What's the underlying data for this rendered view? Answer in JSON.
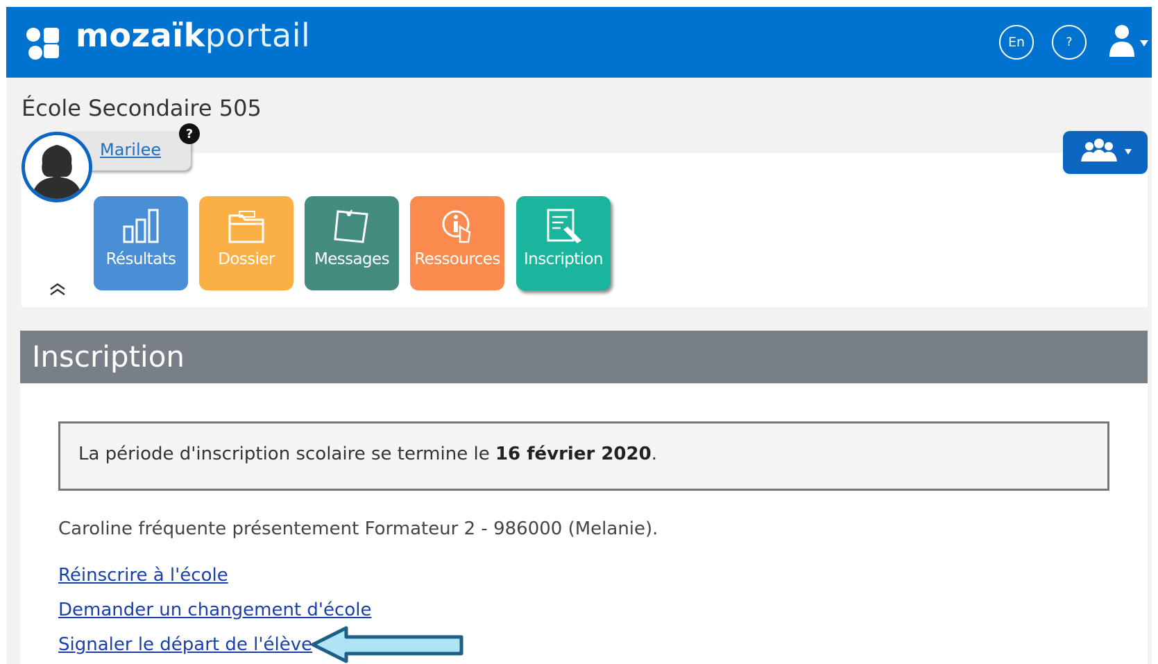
{
  "header": {
    "brand_bold": "mozaïk",
    "brand_light": "portail",
    "language_label": "En",
    "help_label": "?"
  },
  "school": {
    "name": "École Secondaire 505"
  },
  "student": {
    "name": "Marilee",
    "help_badge": "?"
  },
  "nav_tiles": [
    {
      "label": "Résultats",
      "color": "#4a8fd6",
      "icon": "bar-chart-icon"
    },
    {
      "label": "Dossier",
      "color": "#fbb046",
      "icon": "folder-icon"
    },
    {
      "label": "Messages",
      "color": "#458c80",
      "icon": "note-icon"
    },
    {
      "label": "Ressources",
      "color": "#fa8a4e",
      "icon": "info-touch-icon"
    },
    {
      "label": "Inscription",
      "color": "#1ab59c",
      "icon": "form-pencil-icon",
      "active": true
    }
  ],
  "section": {
    "title": "Inscription",
    "notice_prefix": "La période d'inscription scolaire se termine le ",
    "notice_date": "16 février 2020",
    "notice_suffix": ".",
    "attendance_text": "Caroline fréquente présentement Formateur 2 - 986000 (Melanie).",
    "links": [
      "Réinscrire à l'école",
      "Demander un changement d'école",
      "Signaler le départ de l'élève"
    ]
  },
  "colors": {
    "topbar": "#0073d1",
    "section_header": "#787f86",
    "link": "#1a3fa8",
    "arrow_fill": "#aee4f4",
    "arrow_stroke": "#1d5f86"
  }
}
